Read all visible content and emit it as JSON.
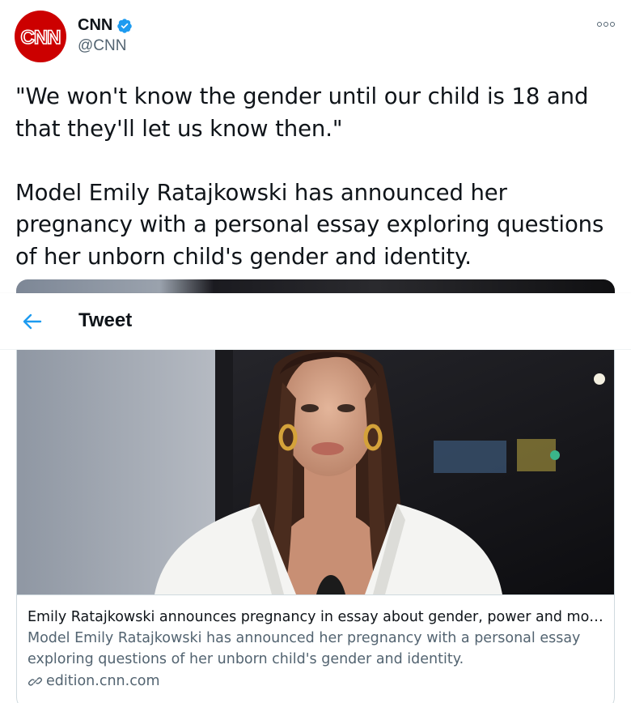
{
  "user": {
    "name": "CNN",
    "handle": "@CNN",
    "avatar_text": "CNN",
    "verified": true
  },
  "tweet": {
    "text": "\"We won't know the gender until our child is 18 and that they'll let us know then.\"\n\nModel Emily Ratajkowski has announced her pregnancy with a personal essay exploring questions of her unborn child's gender and identity."
  },
  "overlay": {
    "title": "Tweet",
    "back_icon": "arrow-left-icon"
  },
  "card": {
    "title": "Emily Ratajkowski announces pregnancy in essay about gender, power and moth...",
    "description": "Model Emily Ratajkowski has announced her pregnancy with a personal essay exploring questions of her unborn child's gender and identity.",
    "domain": "edition.cnn.com",
    "domain_icon": "link-icon"
  },
  "colors": {
    "brand_red": "#cc0000",
    "accent_blue": "#1d9bf0",
    "text_primary": "#0f1419",
    "text_secondary": "#536471"
  }
}
